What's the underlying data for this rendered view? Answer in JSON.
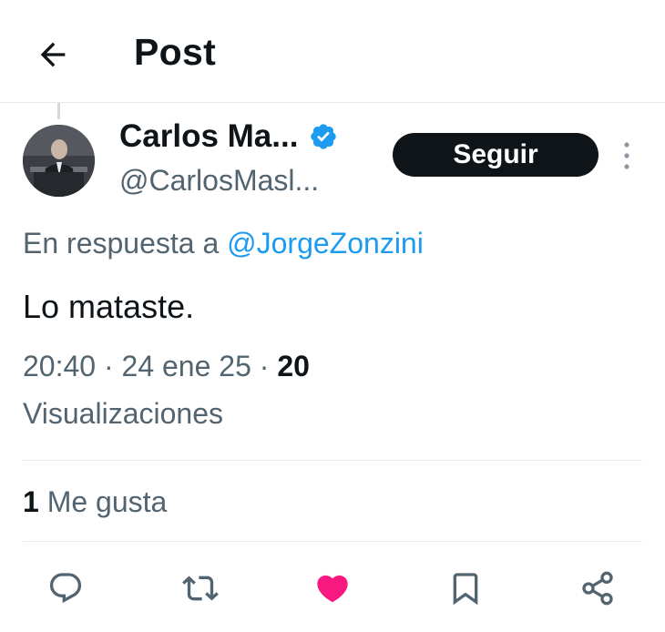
{
  "header": {
    "title": "Post",
    "back_icon": "arrow-left-icon"
  },
  "author": {
    "name": "Carlos Ma...",
    "handle": "@CarlosMasl...",
    "verified": true,
    "verified_color": "#1d9bf0",
    "avatar": "avatar-photo"
  },
  "follow_button": {
    "label": "Seguir",
    "background": "#0f1419",
    "color": "#ffffff"
  },
  "more_icon": "more-vertical-icon",
  "reply": {
    "prefix": "En respuesta a",
    "mention": "@JorgeZonzini",
    "mention_color": "#1d9bf0"
  },
  "tweet": {
    "text": "Lo mataste."
  },
  "meta": {
    "time": "20:40",
    "sep1": "·",
    "date": "24 ene 25",
    "sep2": "·",
    "views": "20",
    "views_label": "Visualizaciones"
  },
  "stats": {
    "likes_count": "1",
    "likes_label": "Me gusta"
  },
  "actions": [
    {
      "name": "reply",
      "icon": "comment-icon"
    },
    {
      "name": "retweet",
      "icon": "retweet-icon"
    },
    {
      "name": "like",
      "icon": "heart-icon",
      "active": true,
      "color": "#f91880"
    },
    {
      "name": "bookmark",
      "icon": "bookmark-icon"
    },
    {
      "name": "share",
      "icon": "share-icon"
    }
  ],
  "colors": {
    "text": "#0f1419",
    "secondary": "#536471",
    "divider": "#e7e9ea"
  }
}
